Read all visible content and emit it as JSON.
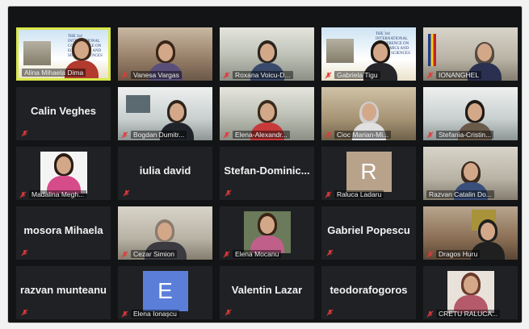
{
  "colors": {
    "background": "#121416",
    "tile": "#1f2124",
    "speaking_border": "#d8e84a",
    "muted_icon": "#e03a3a"
  },
  "participants": [
    {
      "name": "Alina Mihaela Dima",
      "type": "video",
      "muted": false,
      "speaking": true
    },
    {
      "name": "Vanesa Vargas",
      "type": "video",
      "muted": true
    },
    {
      "name": "Roxana Voicu-D...",
      "type": "video",
      "muted": true
    },
    {
      "name": "Gabriela Tigu",
      "type": "video",
      "muted": true
    },
    {
      "name": "IONANGHEL",
      "type": "video",
      "muted": true
    },
    {
      "name": "Calin Veghes",
      "type": "name",
      "muted": true
    },
    {
      "name": "Bogdan Dumitr...",
      "type": "video",
      "muted": true
    },
    {
      "name": "Elena-Alexandr...",
      "type": "video",
      "muted": true
    },
    {
      "name": "Cioc Marian-Mi...",
      "type": "video",
      "muted": true
    },
    {
      "name": "Stefania-Cristin...",
      "type": "video",
      "muted": true
    },
    {
      "name": "Madalina Megh...",
      "type": "photo",
      "muted": true
    },
    {
      "name": "iulia david",
      "type": "name",
      "muted": true
    },
    {
      "name": "Stefan-Dominic...",
      "type": "name",
      "muted": true
    },
    {
      "name": "Raluca Ladaru",
      "type": "avatar",
      "letter": "R",
      "avatar_color": "#b9a28a",
      "muted": true
    },
    {
      "name": "Razvan Catalin Do...",
      "type": "video",
      "muted": false
    },
    {
      "name": "mosora Mihaela",
      "type": "name",
      "muted": true
    },
    {
      "name": "Cezar Simion",
      "type": "video",
      "muted": true
    },
    {
      "name": "Elena Mocanu",
      "type": "photo",
      "muted": true
    },
    {
      "name": "Gabriel Popescu",
      "type": "name",
      "muted": true
    },
    {
      "name": "Dragos Huru",
      "type": "video",
      "muted": true
    },
    {
      "name": "razvan munteanu",
      "type": "name",
      "muted": true
    },
    {
      "name": "Elena Ionașcu",
      "type": "avatar",
      "letter": "E",
      "avatar_color": "#5b7fd9",
      "muted": true
    },
    {
      "name": "Valentin Lazar",
      "type": "name",
      "muted": true
    },
    {
      "name": "teodorafogoros",
      "type": "name",
      "muted": true
    },
    {
      "name": "CRETU RALUCA...",
      "type": "photo",
      "muted": true
    }
  ],
  "poster_text": "THE 3rd INTERNATIONAL CONFERENCE ON ECONOMICS AND SOCIAL SCIENCES"
}
